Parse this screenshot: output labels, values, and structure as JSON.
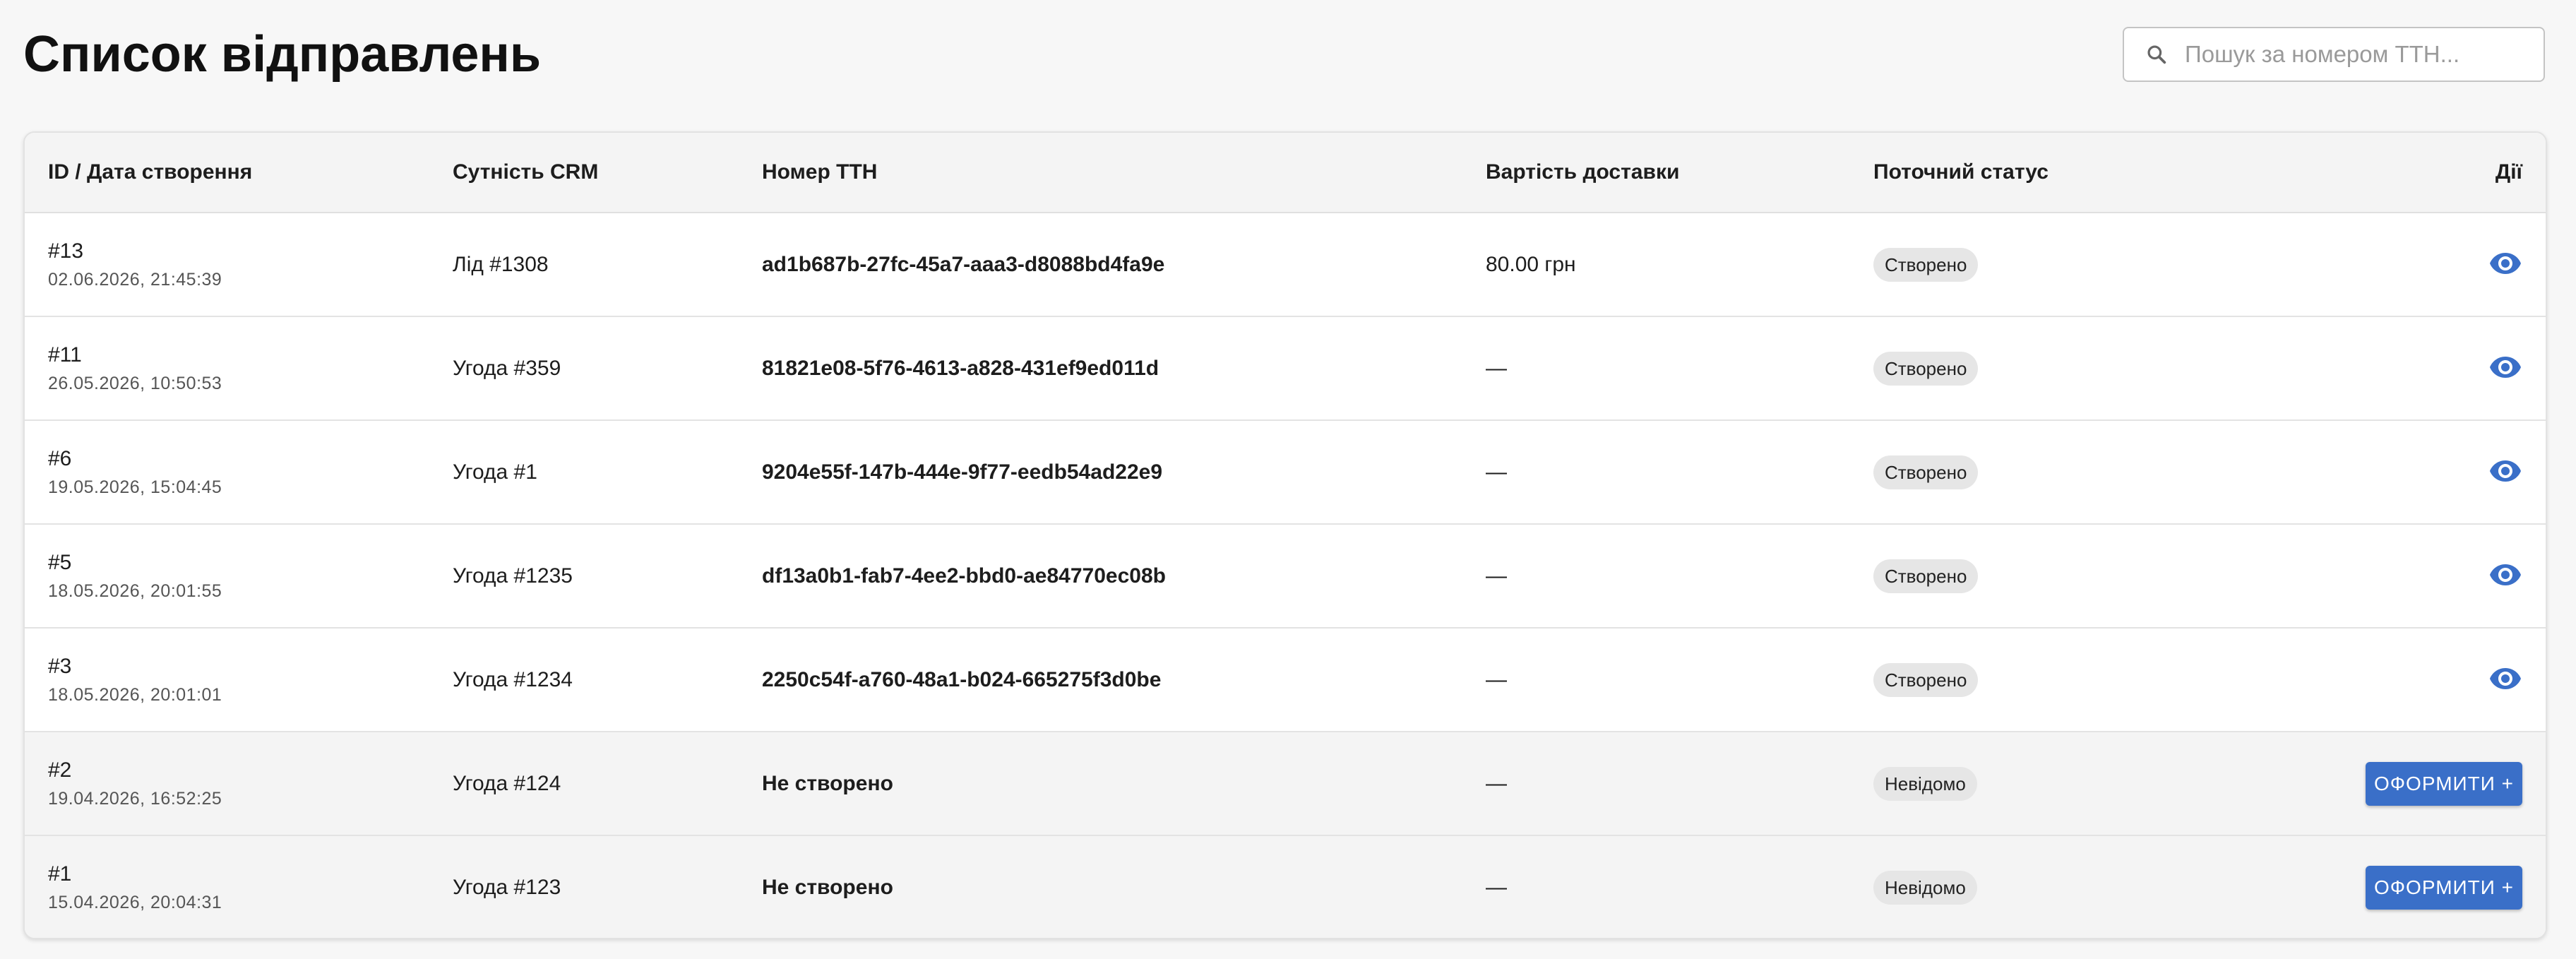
{
  "page": {
    "title": "Список відправлень"
  },
  "search": {
    "placeholder": "Пошук за номером ТТН...",
    "value": ""
  },
  "table": {
    "headers": {
      "id_date": "ID / Дата створення",
      "crm": "Сутність CRM",
      "ttn": "Номер ТТН",
      "cost": "Вартість доставки",
      "status": "Поточний статус",
      "actions": "Дії"
    },
    "rows": [
      {
        "id": "#13",
        "date": "02.06.2026, 21:45:39",
        "crm": "Лід #1308",
        "ttn": "ad1b687b-27fc-45a7-aaa3-d8088bd4fa9e",
        "cost": "80.00 грн",
        "status": "Створено",
        "action": "view"
      },
      {
        "id": "#11",
        "date": "26.05.2026, 10:50:53",
        "crm": "Угода #359",
        "ttn": "81821e08-5f76-4613-a828-431ef9ed011d",
        "cost": "—",
        "status": "Створено",
        "action": "view"
      },
      {
        "id": "#6",
        "date": "19.05.2026, 15:04:45",
        "crm": "Угода #1",
        "ttn": "9204e55f-147b-444e-9f77-eedb54ad22e9",
        "cost": "—",
        "status": "Створено",
        "action": "view"
      },
      {
        "id": "#5",
        "date": "18.05.2026, 20:01:55",
        "crm": "Угода #1235",
        "ttn": "df13a0b1-fab7-4ee2-bbd0-ae84770ec08b",
        "cost": "—",
        "status": "Створено",
        "action": "view"
      },
      {
        "id": "#3",
        "date": "18.05.2026, 20:01:01",
        "crm": "Угода #1234",
        "ttn": "2250c54f-a760-48a1-b024-665275f3d0be",
        "cost": "—",
        "status": "Створено",
        "action": "view"
      },
      {
        "id": "#2",
        "date": "19.04.2026, 16:52:25",
        "crm": "Угода #124",
        "ttn": "Не створено",
        "cost": "—",
        "status": "Невідомо",
        "action": "create"
      },
      {
        "id": "#1",
        "date": "15.04.2026, 20:04:31",
        "crm": "Угода #123",
        "ttn": "Не створено",
        "cost": "—",
        "status": "Невідомо",
        "action": "create"
      }
    ]
  },
  "buttons": {
    "create_label": "ОФОРМИТИ +"
  },
  "icons": {
    "search": "search-icon",
    "view": "eye-icon"
  },
  "colors": {
    "accent": "#3a6fc8",
    "eye": "#3a6fc8",
    "badge_bg": "#e6e6e6",
    "muted_row": "#f4f4f4"
  }
}
